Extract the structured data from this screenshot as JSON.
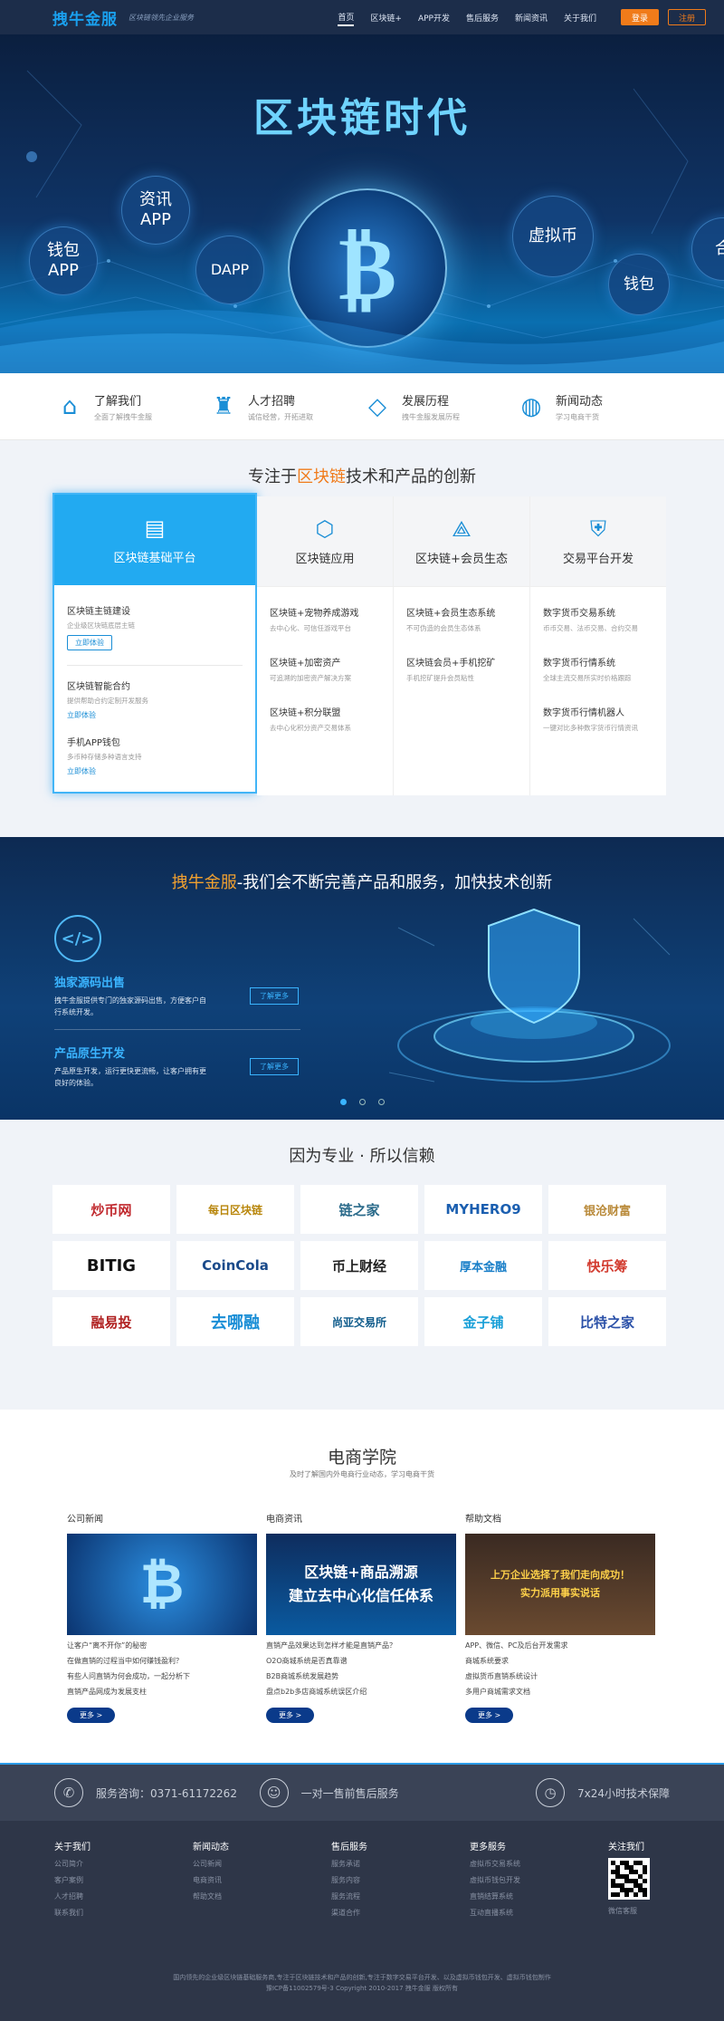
{
  "header": {
    "logo": "拽牛金服",
    "slogan": "区块链领先企业服务",
    "nav": [
      "首页",
      "区块链+",
      "APP开发",
      "售后服务",
      "新闻资讯",
      "关于我们"
    ],
    "login": "登录",
    "register": "注册"
  },
  "hero": {
    "title": "区块链时代",
    "bubbles": [
      "资讯\nAPP",
      "钱包\nAPP",
      "DAPP",
      "虚拟币",
      "钱包",
      "合"
    ],
    "coin_symbol": "₿"
  },
  "quick": [
    {
      "icon": "home-icon",
      "title": "了解我们",
      "sub": "全面了解拽牛金服"
    },
    {
      "icon": "trophy-icon",
      "title": "人才招聘",
      "sub": "诚信经营，开拓进取"
    },
    {
      "icon": "diamond-icon",
      "title": "发展历程",
      "sub": "拽牛金服发展历程"
    },
    {
      "icon": "globe-icon",
      "title": "新闻动态",
      "sub": "学习电商干货"
    }
  ],
  "blockchain": {
    "title_pre": "专注于",
    "title_em": "区块链",
    "title_post": "技术和产品的创新",
    "featured": {
      "title": "区块链基础平台",
      "items": [
        {
          "t": "区块链主链建设",
          "s": "企业级区块链底层主链",
          "b": "立即体验"
        },
        {
          "t": "区块链智能合约",
          "s": "提供帮助合约定制开发服务",
          "b": "立即体验"
        },
        {
          "t": "手机APP钱包",
          "s": "多币种存储多种语言支持",
          "b": "立即体验"
        }
      ]
    },
    "columns": [
      {
        "title": "区块链应用",
        "items": [
          {
            "t": "区块链+宠物养成游戏",
            "s": "去中心化、可信任游戏平台"
          },
          {
            "t": "区块链+加密资产",
            "s": "可追溯的加密资产解决方案"
          },
          {
            "t": "区块链+积分联盟",
            "s": "去中心化积分资产交易体系"
          }
        ]
      },
      {
        "title": "区块链+会员生态",
        "items": [
          {
            "t": "区块链+会员生态系统",
            "s": "不可伪造的会员生态体系"
          },
          {
            "t": "区块链会员+手机挖矿",
            "s": "手机挖矿提升会员粘性"
          }
        ]
      },
      {
        "title": "交易平台开发",
        "items": [
          {
            "t": "数字货币交易系统",
            "s": "币币交易、法币交易、合约交易"
          },
          {
            "t": "数字货币行情系统",
            "s": "全球主流交易所实时价格跟踪"
          },
          {
            "t": "数字货币行情机器人",
            "s": "一键对比多种数字货币行情资讯"
          }
        ]
      }
    ]
  },
  "service": {
    "brand": "拽牛金服",
    "title_rest": "-我们会不断完善产品和服务，加快技术创新",
    "features": [
      {
        "t": "独家源码出售",
        "s": "拽牛金服提供专门的独家源码出售，方便客户自行系统开发。",
        "b": "了解更多"
      },
      {
        "t": "产品原生开发",
        "s": "产品原生开发，运行更快更流畅，让客户拥有更良好的体验。",
        "b": "了解更多"
      }
    ]
  },
  "partners": {
    "title": "因为专业 · 所以信赖",
    "logos": [
      "炒币网",
      "每日区块链",
      "链之家",
      "MYHERO9",
      "银沧财富",
      "BITIG",
      "CoinCola",
      "币上财经",
      "厚本金融",
      "快乐筹",
      "融易投",
      "去哪融",
      "尚亚交易所",
      "金子铺",
      "比特之家"
    ]
  },
  "academy": {
    "title": "电商学院",
    "sub": "及时了解国内外电商行业动态，学习电商干货",
    "columns": [
      {
        "h": "公司新闻",
        "img": "₿",
        "items": [
          "让客户“离不开你”的秘密",
          "在做直销的过程当中如何赚钱盈利？",
          "有些人问直销为何会成功，一起分析下",
          "直销产品网成为发展支柱"
        ],
        "more": "更多 >"
      },
      {
        "h": "电商资讯",
        "img": "区块链+商品溯源\n建立去中心化信任体系",
        "items": [
          "直销产品效果达到怎样才能是直销产品？",
          "O2O商城系统是否真靠谱",
          "B2B商城系统发展趋势",
          "盘点b2b多店商城系统误区介绍"
        ],
        "more": "更多 >"
      },
      {
        "h": "帮助文档",
        "img": "上万企业选择了我们走向成功！\n实力派用事实说话",
        "items": [
          "APP、微信、PC及后台开发需求",
          "商城系统要求",
          "虚拟货币直销系统设计",
          "多用户商城需求文档"
        ],
        "more": "更多 >"
      }
    ]
  },
  "band": [
    {
      "icon": "phone-icon",
      "text": "服务咨询：0371-61172262"
    },
    {
      "icon": "user-icon",
      "text": "一对一售前售后服务"
    },
    {
      "icon": "clock-icon",
      "text": "7x24小时技术保障"
    }
  ],
  "footer": {
    "columns": [
      {
        "h": "关于我们",
        "links": [
          "公司简介",
          "客户案例",
          "人才招聘",
          "联系我们"
        ]
      },
      {
        "h": "新闻动态",
        "links": [
          "公司新闻",
          "电商资讯",
          "帮助文档"
        ]
      },
      {
        "h": "售后服务",
        "links": [
          "服务承诺",
          "服务内容",
          "服务流程",
          "渠道合作"
        ]
      },
      {
        "h": "更多服务",
        "links": [
          "虚拟币交易系统",
          "虚拟币钱包开发",
          "直销结算系统",
          "互动直播系统"
        ]
      },
      {
        "h": "关注我们",
        "links": [
          "微信客服"
        ]
      }
    ],
    "copy1": "国内领先的企业级区块链基础服务商,专注于区块链技术和产品的创新,专注于数字交易平台开发、以及虚拟币钱包开发、虚拟币钱包制作",
    "copy2": "豫ICP备11002579号-3 Copyright 2010-2017 拽牛金服 版权所有"
  }
}
